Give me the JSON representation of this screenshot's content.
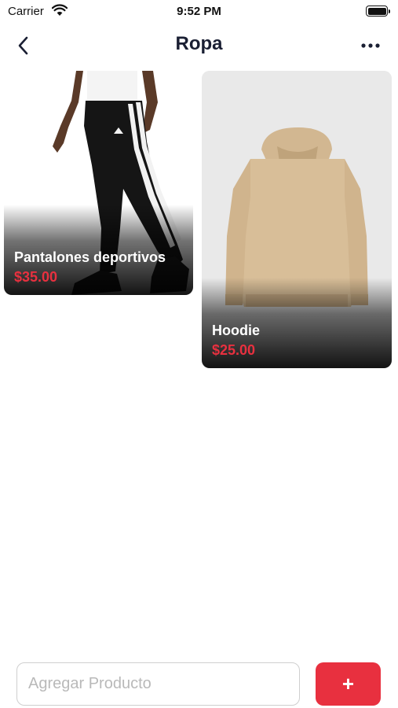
{
  "status_bar": {
    "carrier": "Carrier",
    "time": "9:52 PM",
    "icons": [
      "wifi-icon",
      "battery-icon"
    ]
  },
  "nav": {
    "title": "Ropa",
    "back_icon": "chevron-left-icon",
    "more_icon": "ellipsis-icon"
  },
  "products": [
    {
      "name": "Pantalones deportivos",
      "price": "$35.00",
      "image": "track-pants-photo"
    },
    {
      "name": "Hoodie",
      "price": "$25.00",
      "image": "beige-hoodie-photo"
    }
  ],
  "add_product": {
    "placeholder": "Agregar Producto",
    "value": "",
    "button_label": "+"
  },
  "colors": {
    "accent": "#e8303f",
    "title": "#1a1f33",
    "background": "#ffffff"
  }
}
